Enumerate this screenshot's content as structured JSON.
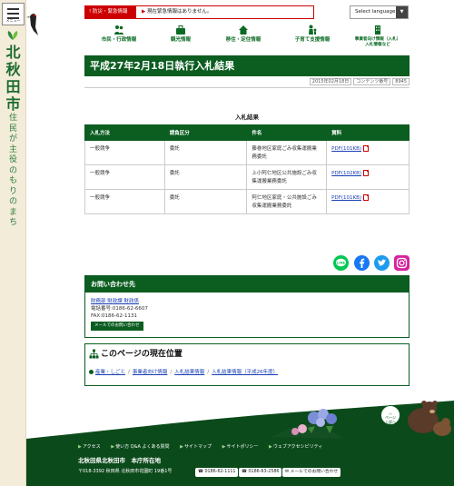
{
  "sidebar": {
    "menu_label": "メニュー",
    "city_name": "北秋田市",
    "slogan": "住民が主役のもりのまち"
  },
  "header": {
    "disaster_tag": "防災・緊急情報",
    "disaster_msg": "現在緊急情報はありません。",
    "language_select": "Select language"
  },
  "gnav": [
    {
      "label": "市民・行政情報"
    },
    {
      "label": "観光情報"
    },
    {
      "label": "移住・定住情報"
    },
    {
      "label": "子育て支援情報"
    },
    {
      "label": "事業者向け情報（入札）\n入札情報など"
    }
  ],
  "page": {
    "title": "平成27年2月18日執行入札結果",
    "date": "2015年02月18日",
    "content_no_label": "コンテンツ番号",
    "content_no": "8945",
    "table_caption": "入札結果"
  },
  "table": {
    "headers": [
      "入札方法",
      "請負区分",
      "件名",
      "資料"
    ],
    "rows": [
      {
        "method": "一般競争",
        "type": "委託",
        "subject": "藤巻地区家庭ごみ収集運搬業務委託",
        "doc": "PDF(101KB)"
      },
      {
        "method": "一般競争",
        "type": "委託",
        "subject": "上小阿仁地区公共施設ごみ収集運搬業務委託",
        "doc": "PDF(102KB)"
      },
      {
        "method": "一般競争",
        "type": "委託",
        "subject": "阿仁地区家庭・公共施設ごみ収集運搬業務委託",
        "doc": "PDF(101KB)"
      }
    ]
  },
  "contact": {
    "heading": "お問い合わせ先",
    "dept": "財務部 財政課 財政係",
    "phone": "電話番号:0186-62-6607",
    "fax": "FAX:0186-62-1131",
    "mail_btn": "メールでのお問い合わせ"
  },
  "location": {
    "heading": "このページの現在位置",
    "crumbs": [
      "産業・しごと",
      "事業者向け情報",
      "入札結果情報",
      "入札結果情報（平成26年度）"
    ]
  },
  "pagetop": "ページ\n上部へ",
  "footer": {
    "links": [
      "アクセス",
      "使い方 Q&A よくある質問",
      "サイトマップ",
      "サイトポリシー",
      "ウェブアクセシビリティ"
    ],
    "office": "北秋田県北秋田市　本庁所在地",
    "address": "〒018-3392  秋田県 北秋田市花園町 19番1号",
    "tel1": "0186-62-1111",
    "tel2": "0186-63-2586",
    "mail": "メールでのお問い合わせ"
  },
  "colors": {
    "brand": "#0b5d20",
    "alert": "#cc0000",
    "link": "#1a3fb3"
  }
}
